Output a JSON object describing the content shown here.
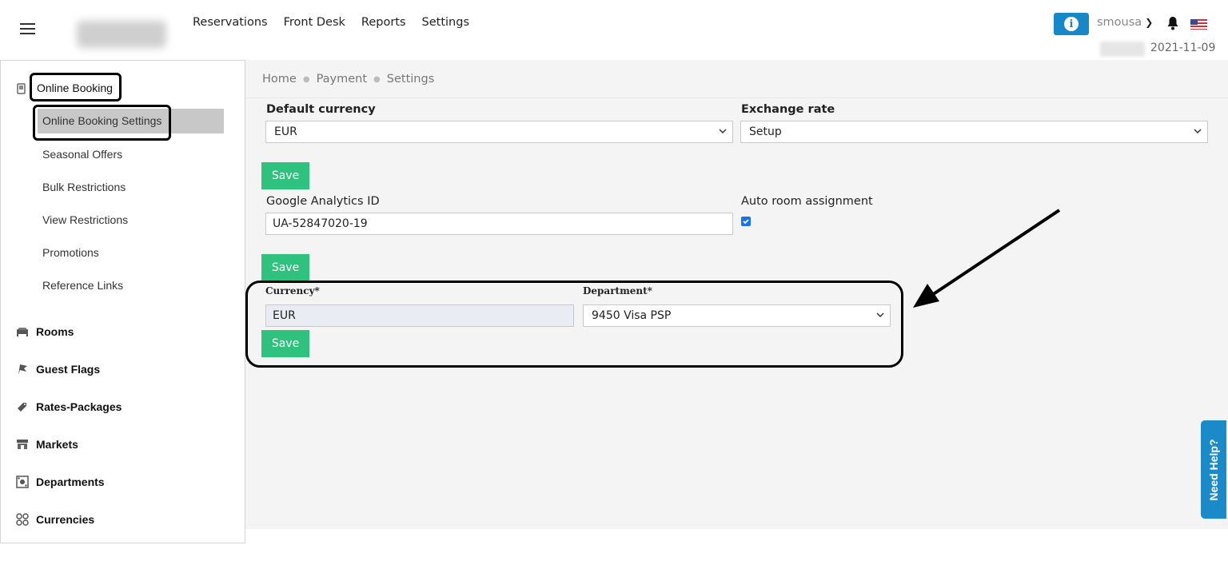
{
  "header": {
    "nav": [
      "Reservations",
      "Front Desk",
      "Reports",
      "Settings"
    ],
    "username": "smousa",
    "date": "2021-11-09"
  },
  "sidebar": {
    "section_title": "Online Booking",
    "sub_items": [
      {
        "label": "Online Booking Settings",
        "active": true
      },
      {
        "label": "Seasonal Offers"
      },
      {
        "label": "Bulk Restrictions"
      },
      {
        "label": "View Restrictions"
      },
      {
        "label": "Promotions"
      },
      {
        "label": "Reference Links"
      }
    ],
    "items": [
      {
        "label": "Rooms",
        "icon": "bed-icon"
      },
      {
        "label": "Guest Flags",
        "icon": "flag-icon"
      },
      {
        "label": "Rates-Packages",
        "icon": "tag-icon"
      },
      {
        "label": "Markets",
        "icon": "store-icon"
      },
      {
        "label": "Departments",
        "icon": "departments-icon"
      },
      {
        "label": "Currencies",
        "icon": "currencies-icon"
      }
    ]
  },
  "breadcrumb": [
    "Home",
    "Payment",
    "Settings"
  ],
  "form": {
    "default_currency_label": "Default currency",
    "default_currency_value": "EUR",
    "exchange_rate_label": "Exchange rate",
    "exchange_rate_value": "Setup",
    "save_label": "Save",
    "ga_label": "Google Analytics ID",
    "ga_value": "UA-52847020-19",
    "auto_room_label": "Auto room assignment",
    "auto_room_checked": true,
    "currency_label": "Currency*",
    "currency_value": "EUR",
    "department_label": "Department*",
    "department_value": "9450 Visa PSP"
  },
  "help_label": "Need Help?",
  "colors": {
    "accent": "#2ec27e",
    "info": "#1687c9",
    "help": "#1a8ac9"
  }
}
